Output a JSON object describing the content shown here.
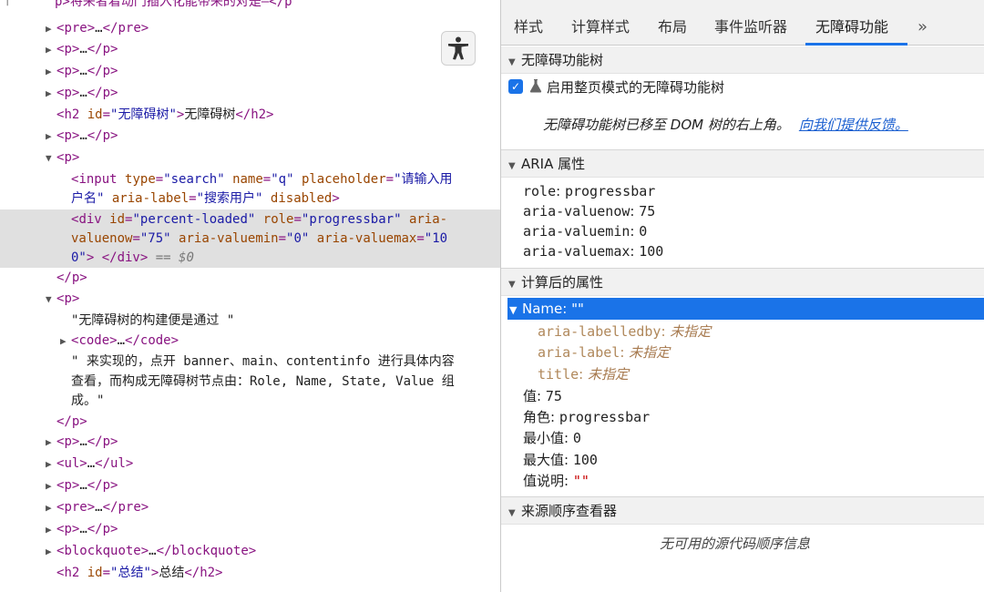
{
  "elements": {
    "top_fragment": "p>将来者着动门插入化能带来的对是—</p",
    "rows": [
      {
        "type": "collapsed",
        "tag": "pre"
      },
      {
        "type": "collapsed",
        "tag": "p"
      },
      {
        "type": "collapsed",
        "tag": "p"
      },
      {
        "type": "collapsed",
        "tag": "p"
      },
      {
        "type": "heading",
        "tag": "h2",
        "attr_name": "id",
        "attr_value": "\"无障碍树\"",
        "text": "无障碍树"
      },
      {
        "type": "collapsed",
        "tag": "p"
      },
      {
        "type": "open",
        "tag": "p"
      }
    ],
    "input_line1": {
      "tag": "input",
      "a1": "type",
      "v1": "\"search\"",
      "a2": "name",
      "v2": "\"q\"",
      "a3": "placeholder",
      "v3": "\"请输入用"
    },
    "input_line2": {
      "v3cont": "户名\"",
      "a4": "aria-label",
      "v4": "\"搜索用户\"",
      "a5": "disabled"
    },
    "div_line1": {
      "tag": "div",
      "a1": "id",
      "v1": "\"percent-loaded\"",
      "a2": "role",
      "v2": "\"progressbar\"",
      "a3": "aria-"
    },
    "div_line2": {
      "a3cont": "valuenow",
      "v3": "\"75\"",
      "a4": "aria-valuemin",
      "v4": "\"0\"",
      "a5": "aria-valuemax",
      "v5": "\"10"
    },
    "div_line3": {
      "v5cont": "0\"",
      "close": "div",
      "eq": "==",
      "dollar": "$0"
    },
    "close_p": "p",
    "p2_open": "p",
    "text1": "\"无障碍树的构建便是通过 \"",
    "code_tag": "code",
    "text2_l1": "\" 来实现的，点开 banner、main、contentinfo 进行具体内容",
    "text2_l2": "查看，而构成无障碍树节点由：Role, Name, State, Value 组",
    "text2_l3": "成。\"",
    "close_p2": "p",
    "after_rows": [
      {
        "tag": "p"
      },
      {
        "tag": "ul"
      },
      {
        "tag": "p"
      },
      {
        "tag": "pre"
      },
      {
        "tag": "p"
      },
      {
        "tag": "blockquote"
      }
    ],
    "last_heading": {
      "tag": "h2",
      "attr_name": "id",
      "attr_value": "\"总结\"",
      "text": "总结"
    },
    "ellipsis": "…"
  },
  "tabs": [
    "样式",
    "计算样式",
    "布局",
    "事件监听器",
    "无障碍功能"
  ],
  "tabs_more": "»",
  "active_tab": "无障碍功能",
  "a11y_tree": {
    "title": "无障碍功能树",
    "checkbox_label": "启用整页模式的无障碍功能树",
    "checked": true,
    "moved_text": "无障碍功能树已移至 DOM 树的右上角。",
    "feedback_link": "向我们提供反馈。"
  },
  "aria": {
    "title": "ARIA 属性",
    "props": [
      {
        "k": "role",
        "v": "progressbar"
      },
      {
        "k": "aria-valuenow",
        "v": "75"
      },
      {
        "k": "aria-valuemin",
        "v": "0"
      },
      {
        "k": "aria-valuemax",
        "v": "100"
      }
    ]
  },
  "computed": {
    "title": "计算后的属性",
    "name_label": "Name: \"\"",
    "name_sub": [
      {
        "k": "aria-labelledby",
        "v": "未指定"
      },
      {
        "k": "aria-label",
        "v": "未指定"
      },
      {
        "k": "title",
        "v": "未指定"
      }
    ],
    "props": [
      {
        "k": "值",
        "v": "75"
      },
      {
        "k": "角色",
        "v": "progressbar"
      },
      {
        "k": "最小值",
        "v": "0"
      },
      {
        "k": "最大值",
        "v": "100"
      },
      {
        "k": "值说明",
        "v": "\"\"",
        "red": true
      }
    ]
  },
  "source_order": {
    "title": "来源顺序查看器",
    "empty_text": "无可用的源代码顺序信息"
  },
  "colors": {
    "accent": "#1a73e8",
    "tag": "#881280",
    "attr_name": "#994500",
    "attr_value": "#1a1aa6"
  }
}
